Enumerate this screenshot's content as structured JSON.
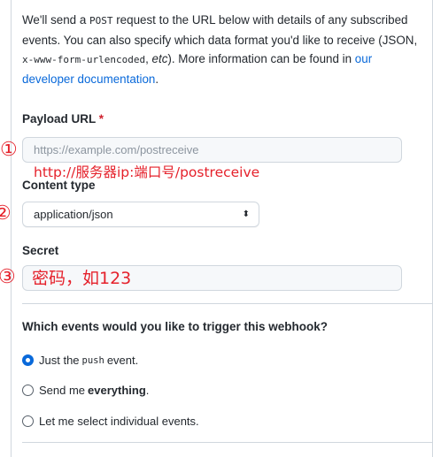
{
  "intro": {
    "text_1": "We'll send a ",
    "code_1": "POST",
    "text_2": " request to the URL below with details of any subscribed events. You can also specify which data format you'd like to receive (JSON, ",
    "code_2": "x-www-form-urlencoded",
    "text_3": ", ",
    "em_1": "etc",
    "text_4": "). More information can be found in ",
    "link": "our developer documentation",
    "text_5": "."
  },
  "payload_url": {
    "label": "Payload URL",
    "required_mark": "*",
    "placeholder": "https://example.com/postreceive"
  },
  "content_type": {
    "label": "Content type",
    "selected": "application/json",
    "chevron": "⬍"
  },
  "secret": {
    "label": "Secret",
    "value": ""
  },
  "annotations": {
    "num_1": "①",
    "num_2": "②",
    "num_3": "③",
    "url_hint": "http://服务器ip:端口号/postreceive",
    "secret_hint": "密码，如123"
  },
  "events": {
    "question": "Which events would you like to trigger this webhook?",
    "options": [
      {
        "prefix": "Just the",
        "code": "push",
        "suffix": "event.",
        "checked": true
      },
      {
        "prefix": "Send me",
        "bold": "everything",
        "suffix": ".",
        "checked": false
      },
      {
        "prefix": "Let me select individual events.",
        "checked": false
      }
    ]
  },
  "colors": {
    "link": "#0969da",
    "required": "#cf222e",
    "annotation": "#e5212b",
    "radio_checked": "#0969da"
  }
}
